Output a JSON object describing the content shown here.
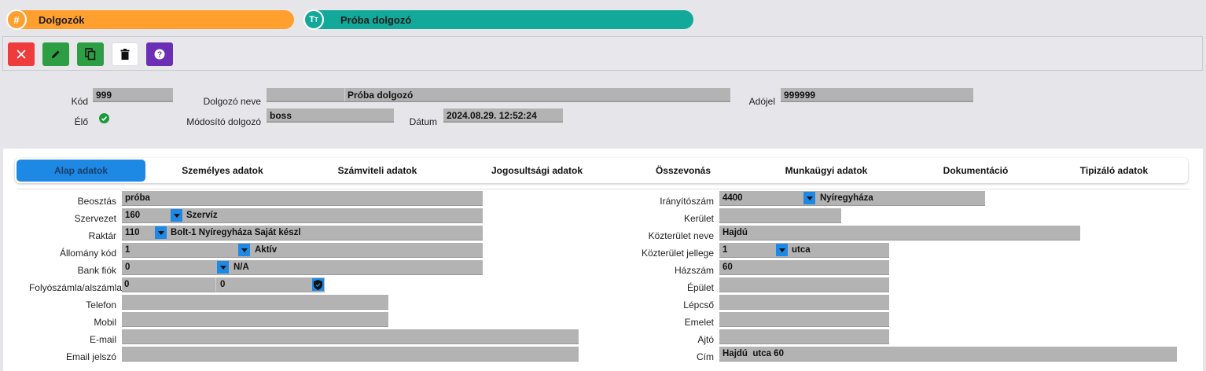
{
  "header": {
    "module_title": "Dolgozók",
    "module_icon": "#",
    "record_title": "Próba dolgozó",
    "record_icon": "TT"
  },
  "toolbar": {
    "buttons": [
      {
        "name": "close-button",
        "icon": "close-icon",
        "color": "#ee3b3b"
      },
      {
        "name": "edit-button",
        "icon": "pencil-icon",
        "color": "#2e9e44"
      },
      {
        "name": "copy-button",
        "icon": "copy-icon",
        "color": "#2e9e44"
      },
      {
        "name": "delete-button",
        "icon": "trash-icon",
        "color": "#ffffff"
      },
      {
        "name": "help-button",
        "icon": "question-icon",
        "color": "#6a2fb5"
      }
    ]
  },
  "record": {
    "kod_label": "Kód",
    "kod_value": "999",
    "elo_label": "Élő",
    "name_label": "Dolgozó neve",
    "name_value": "Próba dolgozó",
    "modifier_label": "Módosító dolgozó",
    "modifier_value": "boss",
    "date_label": "Dátum",
    "date_value": "2024.08.29. 12:52:24",
    "tax_label": "Adójel",
    "tax_value": "999999"
  },
  "tabs": [
    {
      "label": "Alap adatok",
      "active": true
    },
    {
      "label": "Személyes adatok"
    },
    {
      "label": "Számviteli adatok"
    },
    {
      "label": "Jogosultsági adatok"
    },
    {
      "label": "Összevonás"
    },
    {
      "label": "Munkaügyi adatok"
    },
    {
      "label": "Dokumentáció"
    },
    {
      "label": "Tipizáló adatok"
    }
  ],
  "left": {
    "beosztas_label": "Beosztás",
    "beosztas_value": "próba",
    "szervezet_label": "Szervezet",
    "szervezet_code": "160",
    "szervezet_name": "Szervíz",
    "raktar_label": "Raktár",
    "raktar_code": "110",
    "raktar_name": "Bolt-1 Nyíregyháza Saját készl",
    "allomany_label": "Állomány kód",
    "allomany_code": "1",
    "allomany_name": "Aktív",
    "bank_label": "Bank fiók",
    "bank_code": "0",
    "bank_name": "N/A",
    "folyo_label": "Folyószámla/alszámla",
    "folyo_1": "0",
    "folyo_2": "0",
    "telefon_label": "Telefon",
    "mobil_label": "Mobil",
    "email_label": "E-mail",
    "emailpw_label": "Email jelszó"
  },
  "right": {
    "irsz_label": "Irányítószám",
    "irsz_code": "4400",
    "irsz_city": "Nyíregyháza",
    "kerulet_label": "Kerület",
    "kozterulet_label": "Közterület neve",
    "kozterulet_value": "Hajdú",
    "jelleg_label": "Közterület jellege",
    "jelleg_code": "1",
    "jelleg_name": "utca",
    "hazszam_label": "Házszám",
    "hazszam_value": "60",
    "epulet_label": "Épület",
    "lepcso_label": "Lépcső",
    "emelet_label": "Emelet",
    "ajto_label": "Ajtó",
    "cim_label": "Cím",
    "cim_value": "Hajdú  utca 60"
  },
  "colors": {
    "module_pill": "#ffa02e",
    "record_pill": "#12a99a",
    "active_tab": "#1e88e5",
    "field_bg": "#b3b3b3",
    "check": "#1a9a3a"
  }
}
